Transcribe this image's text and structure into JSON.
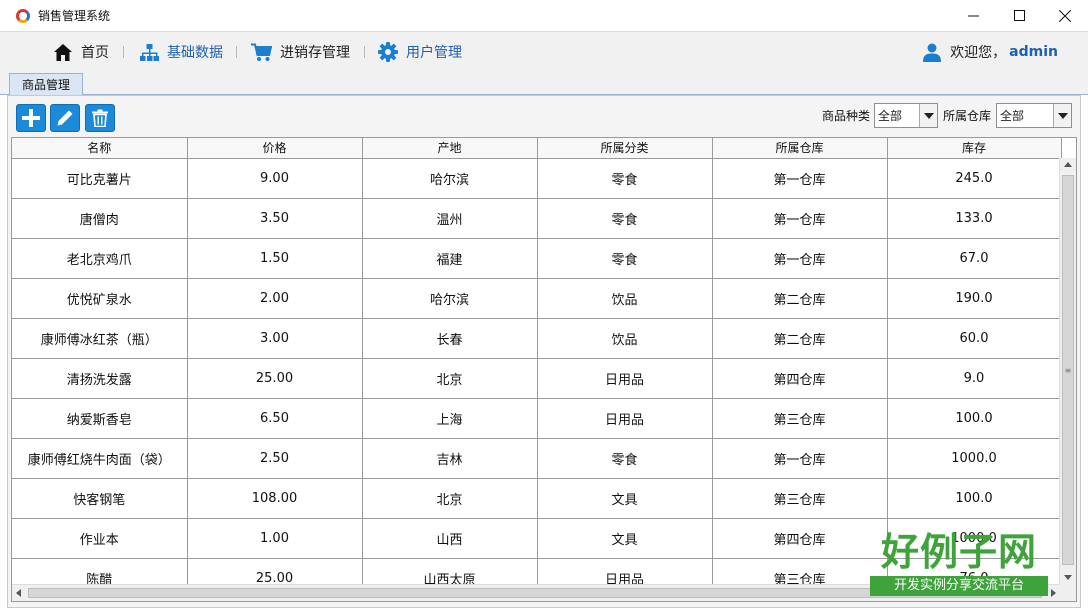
{
  "window": {
    "title": "销售管理系统",
    "controls": {
      "minimize": "—",
      "maximize": "☐",
      "close": "✕"
    }
  },
  "nav": {
    "items": [
      {
        "label": "首页",
        "icon": "home-icon"
      },
      {
        "label": "基础数据",
        "icon": "sitemap-icon"
      },
      {
        "label": "进销存管理",
        "icon": "cart-icon"
      },
      {
        "label": "用户管理",
        "icon": "gear-icon"
      }
    ],
    "user": {
      "greeting": "欢迎您，",
      "name": "admin",
      "icon": "user-icon"
    }
  },
  "tabs": [
    {
      "label": "商品管理"
    }
  ],
  "toolbar": {
    "buttons": [
      {
        "icon": "add-icon"
      },
      {
        "icon": "edit-icon"
      },
      {
        "icon": "delete-icon"
      }
    ],
    "filters": {
      "category": {
        "label": "商品种类",
        "value": "全部"
      },
      "warehouse": {
        "label": "所属仓库",
        "value": "全部"
      }
    }
  },
  "table": {
    "columns": [
      "名称",
      "价格",
      "产地",
      "所属分类",
      "所属仓库",
      "库存"
    ],
    "rows": [
      [
        "可比克薯片",
        "9.00",
        "哈尔滨",
        "零食",
        "第一仓库",
        "245.0"
      ],
      [
        "唐僧肉",
        "3.50",
        "温州",
        "零食",
        "第一仓库",
        "133.0"
      ],
      [
        "老北京鸡爪",
        "1.50",
        "福建",
        "零食",
        "第一仓库",
        "67.0"
      ],
      [
        "优悦矿泉水",
        "2.00",
        "哈尔滨",
        "饮品",
        "第二仓库",
        "190.0"
      ],
      [
        "康师傅冰红茶（瓶）",
        "3.00",
        "长春",
        "饮品",
        "第二仓库",
        "60.0"
      ],
      [
        "清扬洗发露",
        "25.00",
        "北京",
        "日用品",
        "第四仓库",
        "9.0"
      ],
      [
        "纳爱斯香皂",
        "6.50",
        "上海",
        "日用品",
        "第三仓库",
        "100.0"
      ],
      [
        "康师傅红烧牛肉面（袋）",
        "2.50",
        "吉林",
        "零食",
        "第一仓库",
        "1000.0"
      ],
      [
        "快客钢笔",
        "108.00",
        "北京",
        "文具",
        "第三仓库",
        "100.0"
      ],
      [
        "作业本",
        "1.00",
        "山西",
        "文具",
        "第四仓库",
        "1000.0"
      ],
      [
        "陈醋",
        "25.00",
        "山西太原",
        "日用品",
        "第三仓库",
        "76.0"
      ]
    ]
  },
  "watermark": {
    "title": "好例子网",
    "subtitle": "开发实例分享交流平台"
  },
  "colors": {
    "accent": "#1b8ad8",
    "nav_text": "#1e5fb0",
    "watermark": "#3ea33a"
  }
}
